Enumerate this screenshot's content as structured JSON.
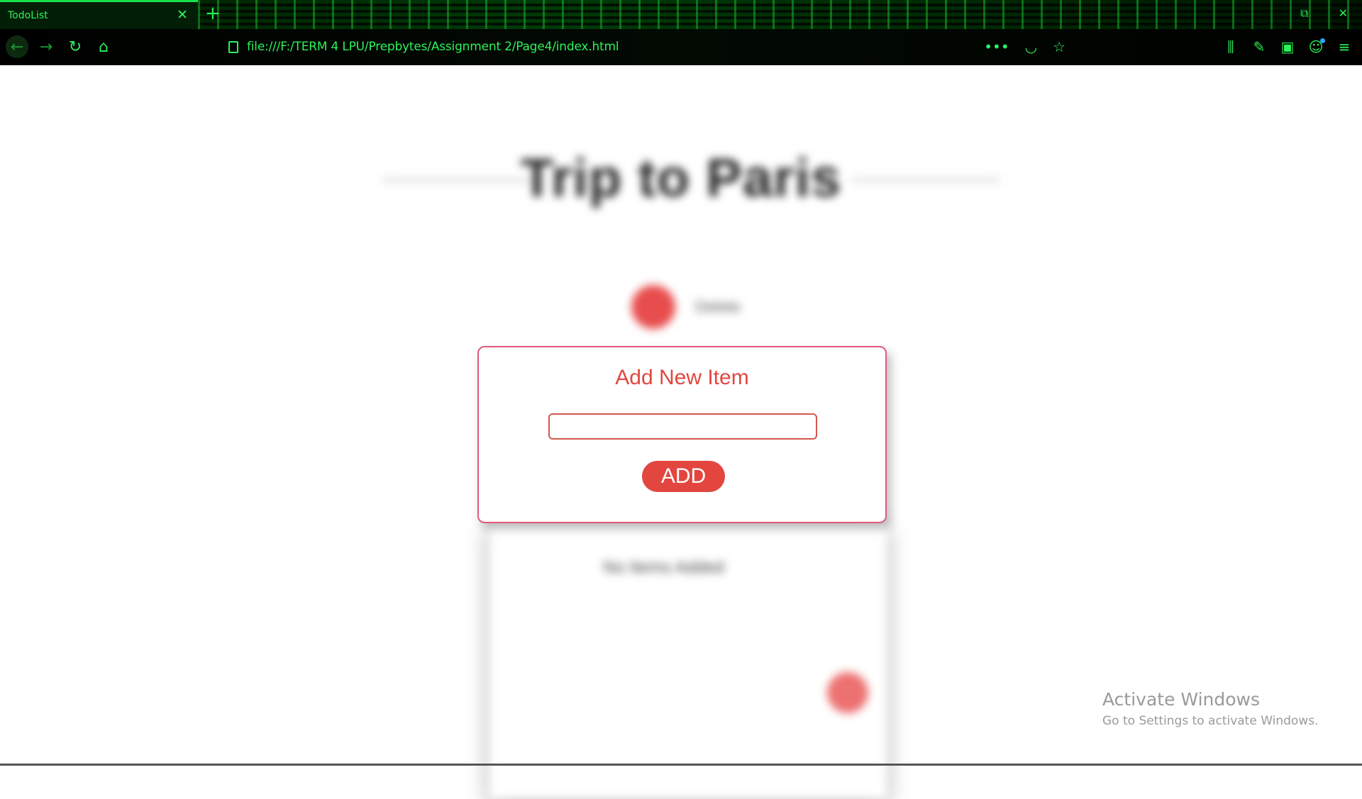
{
  "browser": {
    "tab": {
      "title": "TodoList",
      "close_glyph": "✕"
    },
    "new_tab_glyph": "+",
    "window_controls": {
      "restore_glyph": "⧉",
      "close_glyph": "✕"
    },
    "nav": {
      "back_glyph": "←",
      "forward_glyph": "→",
      "reload_glyph": "↻",
      "home_glyph": "⌂"
    },
    "url": "file:///F:/TERM 4 LPU/Prepbytes/Assignment 2/Page4/index.html",
    "url_actions": {
      "more_glyph": "•••",
      "pocket_glyph": "◡",
      "bookmark_glyph": "☆"
    },
    "toolbar": {
      "library_glyph": "⫼",
      "tools_glyph": "✎",
      "sidebar_glyph": "▣",
      "account_glyph": "☺",
      "menu_glyph": "≡"
    },
    "accent_color": "#2cf25a"
  },
  "background_page": {
    "title": "Trip to Paris",
    "item_label": "Delete",
    "card_text": "No Items Added"
  },
  "modal": {
    "title": "Add New Item",
    "input_value": "",
    "input_placeholder": "",
    "add_label": "ADD",
    "accent_color": "#e2463f",
    "border_color": "#e25a7a"
  },
  "watermark": {
    "line1": "Activate Windows",
    "line2": "Go to Settings to activate Windows."
  }
}
